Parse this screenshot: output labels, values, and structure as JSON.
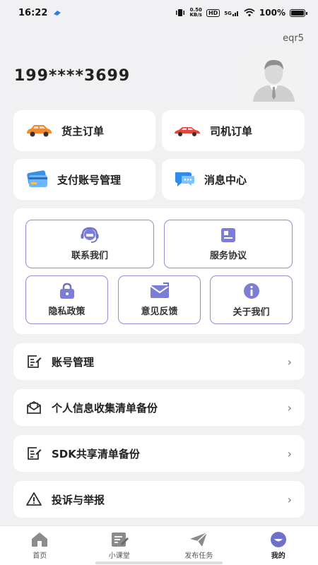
{
  "status": {
    "time": "16:22",
    "speed_top": "0.50",
    "speed_bottom": "KB/s",
    "hd": "HD",
    "net": "5G",
    "battery": "100%"
  },
  "profile": {
    "username": "eqr5",
    "phone": "199****3699"
  },
  "quick": {
    "shipper_orders": "货主订单",
    "driver_orders": "司机订单",
    "payment_account": "支付账号管理",
    "message_center": "消息中心"
  },
  "services": {
    "contact_us": "联系我们",
    "service_agreement": "服务协议",
    "privacy_policy": "隐私政策",
    "feedback": "意见反馈",
    "about_us": "关于我们"
  },
  "menu": [
    {
      "label": "账号管理"
    },
    {
      "label": "个人信息收集清单备份"
    },
    {
      "label": "SDK共享清单备份"
    },
    {
      "label": "投诉与举报"
    }
  ],
  "tabs": [
    {
      "label": "首页"
    },
    {
      "label": "小课堂"
    },
    {
      "label": "发布任务"
    },
    {
      "label": "我的"
    }
  ],
  "colors": {
    "accent": "#6f72c9",
    "card_border": "#8d8fd0",
    "background": "#f1f1f3"
  }
}
